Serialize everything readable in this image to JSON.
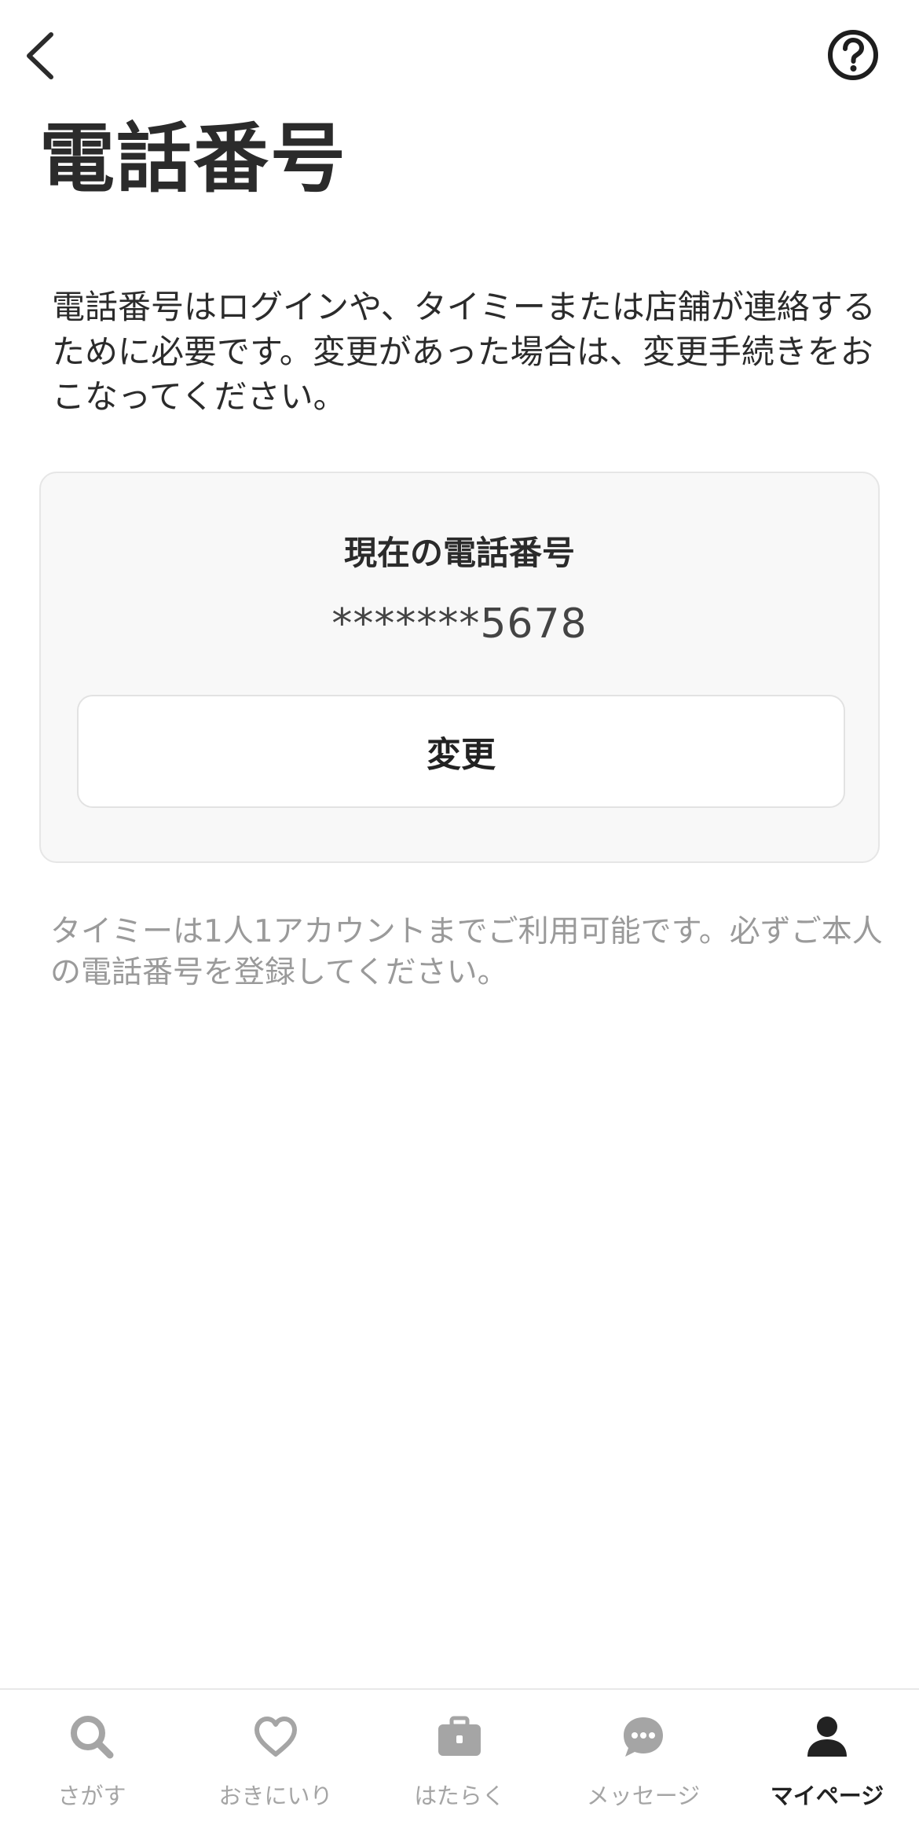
{
  "header": {
    "back_icon": "chevron-left-icon",
    "help_icon": "question-circle-icon",
    "title": "電話番号"
  },
  "description": "電話番号はログインや、タイミーまたは店舗が連絡するために必要です。変更があった場合は、変更手続きをおこなってください。",
  "current_phone": {
    "label": "現在の電話番号",
    "value": "*******5678",
    "change_button": "変更"
  },
  "note": "タイミーは1人1アカウントまでご利用可能です。必ずご本人の電話番号を登録してください。",
  "colors": {
    "text": "#2b2b2b",
    "muted": "#9a9a9a",
    "tab_inactive": "#a5a5a5",
    "tab_active": "#222222",
    "card_bg": "#f8f8f8"
  },
  "tabbar": {
    "items": [
      {
        "label": "さがす",
        "icon": "search-icon",
        "active": false
      },
      {
        "label": "おきにいり",
        "icon": "heart-icon",
        "active": false
      },
      {
        "label": "はたらく",
        "icon": "briefcase-icon",
        "active": false
      },
      {
        "label": "メッセージ",
        "icon": "chat-bubble-icon",
        "active": false
      },
      {
        "label": "マイページ",
        "icon": "user-icon",
        "active": true
      }
    ]
  }
}
